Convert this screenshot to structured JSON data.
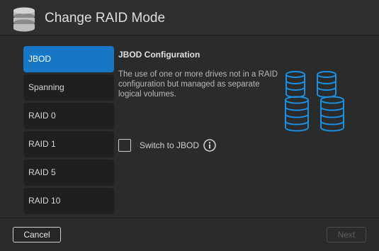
{
  "header": {
    "title": "Change RAID Mode",
    "icon": "database-stack-icon"
  },
  "sidebar": {
    "items": [
      {
        "label": "JBOD",
        "active": true
      },
      {
        "label": "Spanning",
        "active": false
      },
      {
        "label": "RAID 0",
        "active": false
      },
      {
        "label": "RAID 1",
        "active": false
      },
      {
        "label": "RAID 5",
        "active": false
      },
      {
        "label": "RAID 10",
        "active": false
      }
    ]
  },
  "content": {
    "title": "JBOD Configuration",
    "description": "The use of one or more drives not in a RAID configuration but managed as separate logical volumes.",
    "switch_label": "Switch to JBOD",
    "switch_checked": false,
    "art_icon": "jbod-drives-icon"
  },
  "footer": {
    "cancel_label": "Cancel",
    "next_label": "Next",
    "next_enabled": false
  },
  "colors": {
    "accent": "#1677c7",
    "background": "#2b2b2b",
    "drive_outline": "#1a8fe3"
  }
}
